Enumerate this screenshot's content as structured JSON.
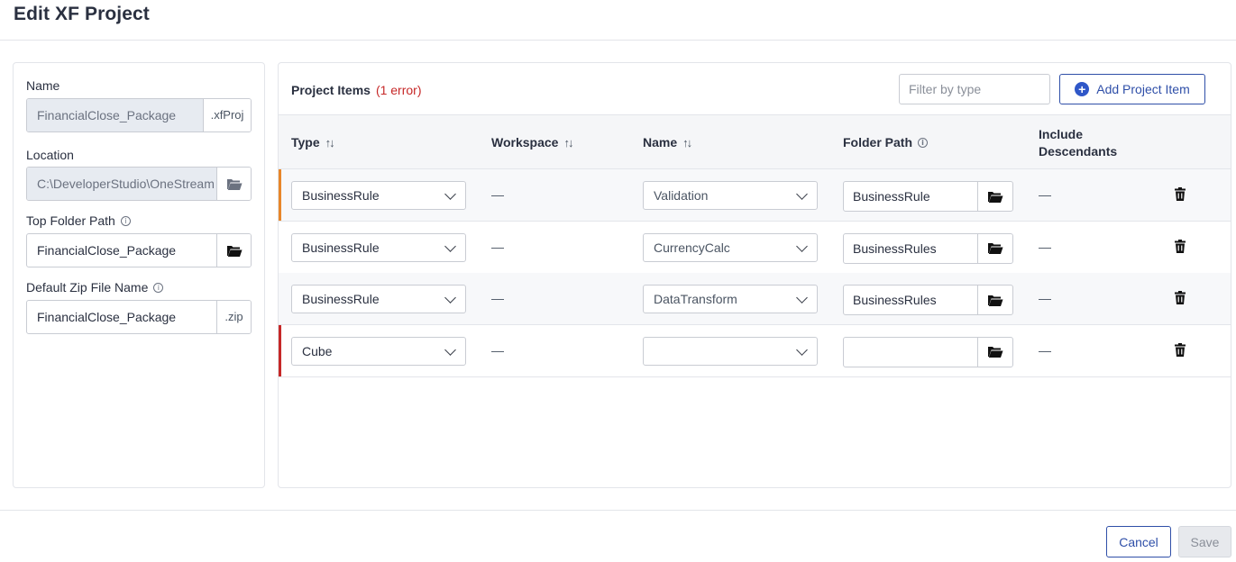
{
  "dialog": {
    "title": "Edit XF Project"
  },
  "form": {
    "name": {
      "label": "Name",
      "value": "FinancialClose_Package",
      "suffix": ".xfProj"
    },
    "location": {
      "label": "Location",
      "value": "C:\\DeveloperStudio\\OneStream"
    },
    "top_folder": {
      "label": "Top Folder Path",
      "value": "FinancialClose_Package"
    },
    "zip": {
      "label": "Default Zip File Name",
      "value": "FinancialClose_Package",
      "suffix": ".zip"
    }
  },
  "items": {
    "title": "Project Items",
    "error_text": "(1 error)",
    "filter_placeholder": "Filter by type",
    "add_label": "Add Project Item",
    "columns": {
      "type": "Type",
      "workspace": "Workspace",
      "name": "Name",
      "folder": "Folder Path",
      "include_1": "Include",
      "include_2": "Descendants"
    },
    "rows": [
      {
        "type": "BusinessRule",
        "workspace": "—",
        "name": "Validation",
        "folder": "BusinessRule",
        "include": "—",
        "status": "warning"
      },
      {
        "type": "BusinessRule",
        "workspace": "—",
        "name": "CurrencyCalc",
        "folder": "BusinessRules",
        "include": "—",
        "status": "ok"
      },
      {
        "type": "BusinessRule",
        "workspace": "—",
        "name": "DataTransform",
        "folder": "BusinessRules",
        "include": "—",
        "status": "ok"
      },
      {
        "type": "Cube",
        "workspace": "—",
        "name": "",
        "folder": "",
        "include": "—",
        "status": "error"
      }
    ]
  },
  "footer": {
    "cancel_label": "Cancel",
    "save_label": "Save"
  },
  "colors": {
    "accent": "#2f4fa8",
    "error": "#c62828",
    "warning": "#e8862a"
  },
  "icons": [
    "folder-open-icon",
    "info-icon",
    "sort-icon",
    "plus-circle-icon",
    "chevron-down-icon",
    "trash-icon"
  ]
}
